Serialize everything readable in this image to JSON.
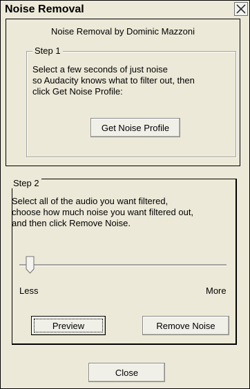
{
  "window": {
    "title": "Noise Removal"
  },
  "header": {
    "credit": "Noise Removal by Dominic Mazzoni"
  },
  "step1": {
    "legend": "Step 1",
    "description_line1": "Select a few seconds of just noise",
    "description_line2": "so Audacity knows what to filter out, then",
    "description_line3": "click Get Noise Profile:",
    "button_label": "Get Noise Profile"
  },
  "step2": {
    "legend": "Step 2",
    "description_line1": "Select all of the audio you want filtered,",
    "description_line2": "choose how much noise you want filtered out,",
    "description_line3": "and then click Remove Noise.",
    "slider_min_label": "Less",
    "slider_max_label": "More",
    "slider_value": 0.0,
    "preview_label": "Preview",
    "remove_label": "Remove Noise"
  },
  "footer": {
    "close_label": "Close"
  },
  "icons": {
    "close": "close-icon"
  }
}
